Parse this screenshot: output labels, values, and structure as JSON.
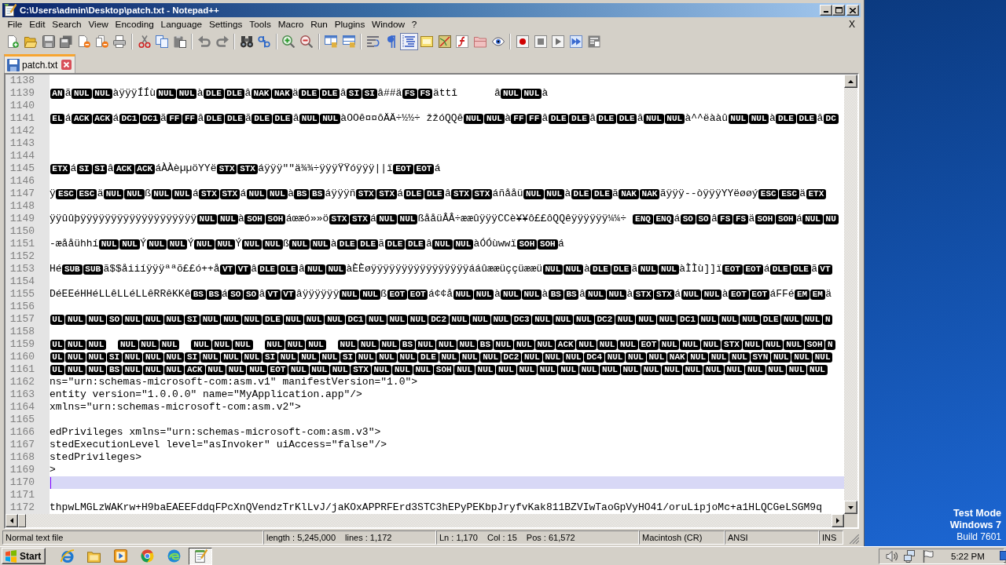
{
  "window": {
    "title": "C:\\Users\\admin\\Desktop\\patch.txt - Notepad++"
  },
  "menu": {
    "items": [
      "File",
      "Edit",
      "Search",
      "View",
      "Encoding",
      "Language",
      "Settings",
      "Tools",
      "Macro",
      "Run",
      "Plugins",
      "Window",
      "?"
    ],
    "close_label": "X"
  },
  "toolbar": {
    "items": [
      {
        "kind": "new",
        "on": false
      },
      {
        "kind": "open",
        "on": false
      },
      {
        "kind": "save",
        "on": false
      },
      {
        "kind": "saveall",
        "on": false
      },
      {
        "kind": "close",
        "on": false
      },
      {
        "kind": "closeall",
        "on": false
      },
      {
        "kind": "print",
        "on": false
      },
      {
        "kind": "sep"
      },
      {
        "kind": "cut",
        "on": false
      },
      {
        "kind": "copy",
        "on": false
      },
      {
        "kind": "paste",
        "on": false
      },
      {
        "kind": "sep"
      },
      {
        "kind": "undo",
        "on": false
      },
      {
        "kind": "redo",
        "on": false
      },
      {
        "kind": "sep"
      },
      {
        "kind": "find",
        "on": false
      },
      {
        "kind": "replace",
        "on": false
      },
      {
        "kind": "sep"
      },
      {
        "kind": "zoomin",
        "on": false
      },
      {
        "kind": "zoomout",
        "on": false
      },
      {
        "kind": "sep"
      },
      {
        "kind": "syncv",
        "on": false
      },
      {
        "kind": "synch",
        "on": false
      },
      {
        "kind": "sep"
      },
      {
        "kind": "wrap",
        "on": false
      },
      {
        "kind": "allchars",
        "on": false
      },
      {
        "kind": "indent",
        "on": true
      },
      {
        "kind": "udl",
        "on": false
      },
      {
        "kind": "docmap",
        "on": false
      },
      {
        "kind": "funclist",
        "on": false
      },
      {
        "kind": "workspace",
        "on": false
      },
      {
        "kind": "monitor",
        "on": false
      },
      {
        "kind": "sep"
      },
      {
        "kind": "record",
        "on": false
      },
      {
        "kind": "stop",
        "on": false
      },
      {
        "kind": "play",
        "on": false
      },
      {
        "kind": "playmulti",
        "on": false
      },
      {
        "kind": "savemacro",
        "on": false
      }
    ]
  },
  "tabs": [
    {
      "label": "patch.txt",
      "selected": true
    }
  ],
  "editor": {
    "lines": [
      {
        "number": "1138",
        "current": false
      },
      {
        "number": "1139",
        "current": false,
        "segments": [
          {
            "kind": "ctrl",
            "text": "AN"
          },
          {
            "kind": "text",
            "text": "ã"
          },
          {
            "kind": "ctrl",
            "text": "NUL"
          },
          {
            "kind": "ctrl",
            "text": "NUL"
          },
          {
            "kind": "text",
            "text": "àÿÿÿÍÍù"
          },
          {
            "kind": "ctrl",
            "text": "NUL"
          },
          {
            "kind": "ctrl",
            "text": "NUL"
          },
          {
            "kind": "text",
            "text": "à"
          },
          {
            "kind": "ctrl",
            "text": "DLE"
          },
          {
            "kind": "ctrl",
            "text": "DLE"
          },
          {
            "kind": "text",
            "text": "â"
          },
          {
            "kind": "ctrl",
            "text": "NAK"
          },
          {
            "kind": "ctrl",
            "text": "NAK"
          },
          {
            "kind": "text",
            "text": "ä"
          },
          {
            "kind": "ctrl",
            "text": "DLE"
          },
          {
            "kind": "ctrl",
            "text": "DLE"
          },
          {
            "kind": "text",
            "text": "â"
          },
          {
            "kind": "ctrl",
            "text": "SI"
          },
          {
            "kind": "ctrl",
            "text": "SI"
          },
          {
            "kind": "text",
            "text": "â##ä"
          },
          {
            "kind": "ctrl",
            "text": "FS"
          },
          {
            "kind": "ctrl",
            "text": "FS"
          },
          {
            "kind": "text",
            "text": "ättî      â"
          },
          {
            "kind": "ctrl",
            "text": "NUL"
          },
          {
            "kind": "ctrl",
            "text": "NUL"
          },
          {
            "kind": "text",
            "text": "à"
          }
        ]
      },
      {
        "number": "1140",
        "current": false
      },
      {
        "number": "1141",
        "current": false,
        "segments": [
          {
            "kind": "ctrl",
            "text": "EL"
          },
          {
            "kind": "text",
            "text": "á"
          },
          {
            "kind": "ctrl",
            "text": "ACK"
          },
          {
            "kind": "ctrl",
            "text": "ACK"
          },
          {
            "kind": "text",
            "text": "á"
          },
          {
            "kind": "ctrl",
            "text": "DC1"
          },
          {
            "kind": "ctrl",
            "text": "DC1"
          },
          {
            "kind": "text",
            "text": "ã"
          },
          {
            "kind": "ctrl",
            "text": "FF"
          },
          {
            "kind": "ctrl",
            "text": "FF"
          },
          {
            "kind": "text",
            "text": "â"
          },
          {
            "kind": "ctrl",
            "text": "DLE"
          },
          {
            "kind": "ctrl",
            "text": "DLE"
          },
          {
            "kind": "text",
            "text": "ã"
          },
          {
            "kind": "ctrl",
            "text": "DLE"
          },
          {
            "kind": "ctrl",
            "text": "DLE"
          },
          {
            "kind": "text",
            "text": "â"
          },
          {
            "kind": "ctrl",
            "text": "NUL"
          },
          {
            "kind": "ctrl",
            "text": "NUL"
          },
          {
            "kind": "text",
            "text": "àOOê¤¤ôÄÄ÷½½÷ žžóQQê"
          },
          {
            "kind": "ctrl",
            "text": "NUL"
          },
          {
            "kind": "ctrl",
            "text": "NUL"
          },
          {
            "kind": "text",
            "text": "à"
          },
          {
            "kind": "ctrl",
            "text": "FF"
          },
          {
            "kind": "ctrl",
            "text": "FF"
          },
          {
            "kind": "text",
            "text": "â"
          },
          {
            "kind": "ctrl",
            "text": "DLE"
          },
          {
            "kind": "ctrl",
            "text": "DLE"
          },
          {
            "kind": "text",
            "text": "â"
          },
          {
            "kind": "ctrl",
            "text": "DLE"
          },
          {
            "kind": "ctrl",
            "text": "DLE"
          },
          {
            "kind": "text",
            "text": "â"
          },
          {
            "kind": "ctrl",
            "text": "NUL"
          },
          {
            "kind": "ctrl",
            "text": "NUL"
          },
          {
            "kind": "text",
            "text": "à^^ëààû"
          },
          {
            "kind": "ctrl",
            "text": "NUL"
          },
          {
            "kind": "ctrl",
            "text": "NUL"
          },
          {
            "kind": "text",
            "text": "à"
          },
          {
            "kind": "ctrl",
            "text": "DLE"
          },
          {
            "kind": "ctrl",
            "text": "DLE"
          },
          {
            "kind": "text",
            "text": "â"
          },
          {
            "kind": "ctrl",
            "text": "DC"
          }
        ]
      },
      {
        "number": "1142",
        "current": false
      },
      {
        "number": "1143",
        "current": false
      },
      {
        "number": "1144",
        "current": false
      },
      {
        "number": "1145",
        "current": false,
        "segments": [
          {
            "kind": "ctrl",
            "text": "ETX"
          },
          {
            "kind": "text",
            "text": "á"
          },
          {
            "kind": "ctrl",
            "text": "SI"
          },
          {
            "kind": "ctrl",
            "text": "SI"
          },
          {
            "kind": "text",
            "text": "â"
          },
          {
            "kind": "ctrl",
            "text": "ACK"
          },
          {
            "kind": "ctrl",
            "text": "ACK"
          },
          {
            "kind": "text",
            "text": "áÀÀèµµöYYë"
          },
          {
            "kind": "ctrl",
            "text": "STX"
          },
          {
            "kind": "ctrl",
            "text": "STX"
          },
          {
            "kind": "text",
            "text": "áÿÿÿ\"\"ä¾¾÷ÿÿÿŸŸóÿÿÿ||ï"
          },
          {
            "kind": "ctrl",
            "text": "EOT"
          },
          {
            "kind": "ctrl",
            "text": "EOT"
          },
          {
            "kind": "text",
            "text": "á"
          }
        ]
      },
      {
        "number": "1146",
        "current": false
      },
      {
        "number": "1147",
        "current": false,
        "segments": [
          {
            "kind": "text",
            "text": "ÿ"
          },
          {
            "kind": "ctrl",
            "text": "ESC"
          },
          {
            "kind": "ctrl",
            "text": "ESC"
          },
          {
            "kind": "text",
            "text": "ä"
          },
          {
            "kind": "ctrl",
            "text": "NUL"
          },
          {
            "kind": "ctrl",
            "text": "NUL"
          },
          {
            "kind": "text",
            "text": "ß"
          },
          {
            "kind": "ctrl",
            "text": "NUL"
          },
          {
            "kind": "ctrl",
            "text": "NUL"
          },
          {
            "kind": "text",
            "text": "á"
          },
          {
            "kind": "ctrl",
            "text": "STX"
          },
          {
            "kind": "ctrl",
            "text": "STX"
          },
          {
            "kind": "text",
            "text": "á"
          },
          {
            "kind": "ctrl",
            "text": "NUL"
          },
          {
            "kind": "ctrl",
            "text": "NUL"
          },
          {
            "kind": "text",
            "text": "à"
          },
          {
            "kind": "ctrl",
            "text": "BS"
          },
          {
            "kind": "ctrl",
            "text": "BS"
          },
          {
            "kind": "text",
            "text": "áÿÿÿñ"
          },
          {
            "kind": "ctrl",
            "text": "STX"
          },
          {
            "kind": "ctrl",
            "text": "STX"
          },
          {
            "kind": "text",
            "text": "á"
          },
          {
            "kind": "ctrl",
            "text": "DLE"
          },
          {
            "kind": "ctrl",
            "text": "DLE"
          },
          {
            "kind": "text",
            "text": "â"
          },
          {
            "kind": "ctrl",
            "text": "STX"
          },
          {
            "kind": "ctrl",
            "text": "STX"
          },
          {
            "kind": "text",
            "text": "áñååü"
          },
          {
            "kind": "ctrl",
            "text": "NUL"
          },
          {
            "kind": "ctrl",
            "text": "NUL"
          },
          {
            "kind": "text",
            "text": "à"
          },
          {
            "kind": "ctrl",
            "text": "DLE"
          },
          {
            "kind": "ctrl",
            "text": "DLE"
          },
          {
            "kind": "text",
            "text": "ã"
          },
          {
            "kind": "ctrl",
            "text": "NAK"
          },
          {
            "kind": "ctrl",
            "text": "NAK"
          },
          {
            "kind": "text",
            "text": "ãÿÿÿ--òÿÿÿYYëøøý"
          },
          {
            "kind": "ctrl",
            "text": "ESC"
          },
          {
            "kind": "ctrl",
            "text": "ESC"
          },
          {
            "kind": "text",
            "text": "ä"
          },
          {
            "kind": "ctrl",
            "text": "ETX"
          }
        ]
      },
      {
        "number": "1148",
        "current": false
      },
      {
        "number": "1149",
        "current": false,
        "segments": [
          {
            "kind": "text",
            "text": "ÿÿûûþÿÿÿÿÿÿÿÿÿÿÿÿÿÿÿÿÿÿÿ"
          },
          {
            "kind": "ctrl",
            "text": "NUL"
          },
          {
            "kind": "ctrl",
            "text": "NUL"
          },
          {
            "kind": "text",
            "text": "à"
          },
          {
            "kind": "ctrl",
            "text": "SOH"
          },
          {
            "kind": "ctrl",
            "text": "SOH"
          },
          {
            "kind": "text",
            "text": "áœæó»»ö"
          },
          {
            "kind": "ctrl",
            "text": "STX"
          },
          {
            "kind": "ctrl",
            "text": "STX"
          },
          {
            "kind": "text",
            "text": "á"
          },
          {
            "kind": "ctrl",
            "text": "NUL"
          },
          {
            "kind": "ctrl",
            "text": "NUL"
          },
          {
            "kind": "text",
            "text": "ßååüÂÂ÷ææûÿÿÿCCè¥¥ô££ôQQêÿÿÿÿÿÿ¼¼÷ "
          },
          {
            "kind": "ctrl",
            "text": "ENQ"
          },
          {
            "kind": "ctrl",
            "text": "ENQ"
          },
          {
            "kind": "text",
            "text": "á"
          },
          {
            "kind": "ctrl",
            "text": "SO"
          },
          {
            "kind": "ctrl",
            "text": "SO"
          },
          {
            "kind": "text",
            "text": "â"
          },
          {
            "kind": "ctrl",
            "text": "FS"
          },
          {
            "kind": "ctrl",
            "text": "FS"
          },
          {
            "kind": "text",
            "text": "ä"
          },
          {
            "kind": "ctrl",
            "text": "SOH"
          },
          {
            "kind": "ctrl",
            "text": "SOH"
          },
          {
            "kind": "text",
            "text": "á"
          },
          {
            "kind": "ctrl",
            "text": "NUL"
          },
          {
            "kind": "ctrl",
            "text": "NU"
          }
        ]
      },
      {
        "number": "1150",
        "current": false
      },
      {
        "number": "1151",
        "current": false,
        "segments": [
          {
            "kind": "text",
            "text": "-æååühhí"
          },
          {
            "kind": "ctrl",
            "text": "NUL"
          },
          {
            "kind": "ctrl",
            "text": "NUL"
          },
          {
            "kind": "text",
            "text": "Ý"
          },
          {
            "kind": "ctrl",
            "text": "NUL"
          },
          {
            "kind": "ctrl",
            "text": "NUL"
          },
          {
            "kind": "text",
            "text": "Ý"
          },
          {
            "kind": "ctrl",
            "text": "NUL"
          },
          {
            "kind": "ctrl",
            "text": "NUL"
          },
          {
            "kind": "text",
            "text": "Ý"
          },
          {
            "kind": "ctrl",
            "text": "NUL"
          },
          {
            "kind": "ctrl",
            "text": "NUL"
          },
          {
            "kind": "text",
            "text": "ß"
          },
          {
            "kind": "ctrl",
            "text": "NUL"
          },
          {
            "kind": "ctrl",
            "text": "NUL"
          },
          {
            "kind": "text",
            "text": "à"
          },
          {
            "kind": "ctrl",
            "text": "DLE"
          },
          {
            "kind": "ctrl",
            "text": "DLE"
          },
          {
            "kind": "text",
            "text": "ã"
          },
          {
            "kind": "ctrl",
            "text": "DLE"
          },
          {
            "kind": "ctrl",
            "text": "DLE"
          },
          {
            "kind": "text",
            "text": "â"
          },
          {
            "kind": "ctrl",
            "text": "NUL"
          },
          {
            "kind": "ctrl",
            "text": "NUL"
          },
          {
            "kind": "text",
            "text": "àÓÓùwwï"
          },
          {
            "kind": "ctrl",
            "text": "SOH"
          },
          {
            "kind": "ctrl",
            "text": "SOH"
          },
          {
            "kind": "text",
            "text": "á"
          }
        ]
      },
      {
        "number": "1152",
        "current": false
      },
      {
        "number": "1153",
        "current": false,
        "segments": [
          {
            "kind": "text",
            "text": "Hé"
          },
          {
            "kind": "ctrl",
            "text": "SUB"
          },
          {
            "kind": "ctrl",
            "text": "SUB"
          },
          {
            "kind": "text",
            "text": "ã$$åiiíÿÿÿªªõ££ó++å"
          },
          {
            "kind": "ctrl",
            "text": "VT"
          },
          {
            "kind": "ctrl",
            "text": "VT"
          },
          {
            "kind": "text",
            "text": "â"
          },
          {
            "kind": "ctrl",
            "text": "DLE"
          },
          {
            "kind": "ctrl",
            "text": "DLE"
          },
          {
            "kind": "text",
            "text": "â"
          },
          {
            "kind": "ctrl",
            "text": "NUL"
          },
          {
            "kind": "ctrl",
            "text": "NUL"
          },
          {
            "kind": "text",
            "text": "àÈÈøÿÿÿÿÿÿÿÿÿÿÿÿÿÿÿÿááûææüççüææü"
          },
          {
            "kind": "ctrl",
            "text": "NUL"
          },
          {
            "kind": "ctrl",
            "text": "NUL"
          },
          {
            "kind": "text",
            "text": "à"
          },
          {
            "kind": "ctrl",
            "text": "DLE"
          },
          {
            "kind": "ctrl",
            "text": "DLE"
          },
          {
            "kind": "text",
            "text": "ã"
          },
          {
            "kind": "ctrl",
            "text": "NUL"
          },
          {
            "kind": "ctrl",
            "text": "NUL"
          },
          {
            "kind": "text",
            "text": "àÌÌù]]ï"
          },
          {
            "kind": "ctrl",
            "text": "EOT"
          },
          {
            "kind": "ctrl",
            "text": "EOT"
          },
          {
            "kind": "text",
            "text": "á"
          },
          {
            "kind": "ctrl",
            "text": "DLE"
          },
          {
            "kind": "ctrl",
            "text": "DLE"
          },
          {
            "kind": "text",
            "text": "ã"
          },
          {
            "kind": "ctrl",
            "text": "VT"
          }
        ]
      },
      {
        "number": "1154",
        "current": false
      },
      {
        "number": "1155",
        "current": false,
        "segments": [
          {
            "kind": "text",
            "text": "DéEEéHHéLLêLLéLLêRRêKKê"
          },
          {
            "kind": "ctrl",
            "text": "BS"
          },
          {
            "kind": "ctrl",
            "text": "BS"
          },
          {
            "kind": "text",
            "text": "á"
          },
          {
            "kind": "ctrl",
            "text": "SO"
          },
          {
            "kind": "ctrl",
            "text": "SO"
          },
          {
            "kind": "text",
            "text": "â"
          },
          {
            "kind": "ctrl",
            "text": "VT"
          },
          {
            "kind": "ctrl",
            "text": "VT"
          },
          {
            "kind": "text",
            "text": "âÿÿÿÿÿÿ"
          },
          {
            "kind": "ctrl",
            "text": "NUL"
          },
          {
            "kind": "ctrl",
            "text": "NUL"
          },
          {
            "kind": "text",
            "text": "ß"
          },
          {
            "kind": "ctrl",
            "text": "EOT"
          },
          {
            "kind": "ctrl",
            "text": "EOT"
          },
          {
            "kind": "text",
            "text": "á¢¢å"
          },
          {
            "kind": "ctrl",
            "text": "NUL"
          },
          {
            "kind": "ctrl",
            "text": "NUL"
          },
          {
            "kind": "text",
            "text": "à"
          },
          {
            "kind": "ctrl",
            "text": "NUL"
          },
          {
            "kind": "ctrl",
            "text": "NUL"
          },
          {
            "kind": "text",
            "text": "à"
          },
          {
            "kind": "ctrl",
            "text": "BS"
          },
          {
            "kind": "ctrl",
            "text": "BS"
          },
          {
            "kind": "text",
            "text": "â"
          },
          {
            "kind": "ctrl",
            "text": "NUL"
          },
          {
            "kind": "ctrl",
            "text": "NUL"
          },
          {
            "kind": "text",
            "text": "à"
          },
          {
            "kind": "ctrl",
            "text": "STX"
          },
          {
            "kind": "ctrl",
            "text": "STX"
          },
          {
            "kind": "text",
            "text": "á"
          },
          {
            "kind": "ctrl",
            "text": "NUL"
          },
          {
            "kind": "ctrl",
            "text": "NUL"
          },
          {
            "kind": "text",
            "text": "à"
          },
          {
            "kind": "ctrl",
            "text": "EOT"
          },
          {
            "kind": "ctrl",
            "text": "EOT"
          },
          {
            "kind": "text",
            "text": "áFFé"
          },
          {
            "kind": "ctrl",
            "text": "EM"
          },
          {
            "kind": "ctrl",
            "text": "EM"
          },
          {
            "kind": "text",
            "text": "ä"
          }
        ]
      },
      {
        "number": "1156",
        "current": false
      },
      {
        "number": "1157",
        "current": false,
        "segments": [
          {
            "kind": "ctrl",
            "text": "UL"
          },
          {
            "kind": "ctrl",
            "text": "NUL"
          },
          {
            "kind": "ctrl",
            "text": "NUL"
          },
          {
            "kind": "ctrl",
            "text": "SO"
          },
          {
            "kind": "ctrl",
            "text": "NUL"
          },
          {
            "kind": "ctrl",
            "text": "NUL"
          },
          {
            "kind": "ctrl",
            "text": "NUL"
          },
          {
            "kind": "ctrl",
            "text": "SI"
          },
          {
            "kind": "ctrl",
            "text": "NUL"
          },
          {
            "kind": "ctrl",
            "text": "NUL"
          },
          {
            "kind": "ctrl",
            "text": "NUL"
          },
          {
            "kind": "ctrl",
            "text": "DLE"
          },
          {
            "kind": "ctrl",
            "text": "NUL"
          },
          {
            "kind": "ctrl",
            "text": "NUL"
          },
          {
            "kind": "ctrl",
            "text": "NUL"
          },
          {
            "kind": "ctrl",
            "text": "DC1"
          },
          {
            "kind": "ctrl",
            "text": "NUL"
          },
          {
            "kind": "ctrl",
            "text": "NUL"
          },
          {
            "kind": "ctrl",
            "text": "NUL"
          },
          {
            "kind": "ctrl",
            "text": "DC2"
          },
          {
            "kind": "ctrl",
            "text": "NUL"
          },
          {
            "kind": "ctrl",
            "text": "NUL"
          },
          {
            "kind": "ctrl",
            "text": "NUL"
          },
          {
            "kind": "ctrl",
            "text": "DC3"
          },
          {
            "kind": "ctrl",
            "text": "NUL"
          },
          {
            "kind": "ctrl",
            "text": "NUL"
          },
          {
            "kind": "ctrl",
            "text": "NUL"
          },
          {
            "kind": "ctrl",
            "text": "DC2"
          },
          {
            "kind": "ctrl",
            "text": "NUL"
          },
          {
            "kind": "ctrl",
            "text": "NUL"
          },
          {
            "kind": "ctrl",
            "text": "NUL"
          },
          {
            "kind": "ctrl",
            "text": "DC1"
          },
          {
            "kind": "ctrl",
            "text": "NUL"
          },
          {
            "kind": "ctrl",
            "text": "NUL"
          },
          {
            "kind": "ctrl",
            "text": "NUL"
          },
          {
            "kind": "ctrl",
            "text": "DLE"
          },
          {
            "kind": "ctrl",
            "text": "NUL"
          },
          {
            "kind": "ctrl",
            "text": "NUL"
          },
          {
            "kind": "ctrl",
            "text": "N"
          }
        ]
      },
      {
        "number": "1158",
        "current": false
      },
      {
        "number": "1159",
        "current": false,
        "segments": [
          {
            "kind": "ctrl",
            "text": "UL"
          },
          {
            "kind": "ctrl",
            "text": "NUL"
          },
          {
            "kind": "ctrl",
            "text": "NUL"
          },
          {
            "kind": "tab"
          },
          {
            "kind": "ctrl",
            "text": "NUL"
          },
          {
            "kind": "ctrl",
            "text": "NUL"
          },
          {
            "kind": "ctrl",
            "text": "NUL"
          },
          {
            "kind": "tab"
          },
          {
            "kind": "ctrl",
            "text": "NUL"
          },
          {
            "kind": "ctrl",
            "text": "NUL"
          },
          {
            "kind": "ctrl",
            "text": "NUL"
          },
          {
            "kind": "tab"
          },
          {
            "kind": "ctrl",
            "text": "NUL"
          },
          {
            "kind": "ctrl",
            "text": "NUL"
          },
          {
            "kind": "ctrl",
            "text": "NUL"
          },
          {
            "kind": "tab"
          },
          {
            "kind": "ctrl",
            "text": "NUL"
          },
          {
            "kind": "ctrl",
            "text": "NUL"
          },
          {
            "kind": "ctrl",
            "text": "NUL"
          },
          {
            "kind": "ctrl",
            "text": "BS"
          },
          {
            "kind": "ctrl",
            "text": "NUL"
          },
          {
            "kind": "ctrl",
            "text": "NUL"
          },
          {
            "kind": "ctrl",
            "text": "NUL"
          },
          {
            "kind": "ctrl",
            "text": "BS"
          },
          {
            "kind": "ctrl",
            "text": "NUL"
          },
          {
            "kind": "ctrl",
            "text": "NUL"
          },
          {
            "kind": "ctrl",
            "text": "NUL"
          },
          {
            "kind": "ctrl",
            "text": "ACK"
          },
          {
            "kind": "ctrl",
            "text": "NUL"
          },
          {
            "kind": "ctrl",
            "text": "NUL"
          },
          {
            "kind": "ctrl",
            "text": "NUL"
          },
          {
            "kind": "ctrl",
            "text": "EOT"
          },
          {
            "kind": "ctrl",
            "text": "NUL"
          },
          {
            "kind": "ctrl",
            "text": "NUL"
          },
          {
            "kind": "ctrl",
            "text": "NUL"
          },
          {
            "kind": "ctrl",
            "text": "STX"
          },
          {
            "kind": "ctrl",
            "text": "NUL"
          },
          {
            "kind": "ctrl",
            "text": "NUL"
          },
          {
            "kind": "ctrl",
            "text": "NUL"
          },
          {
            "kind": "ctrl",
            "text": "SOH"
          },
          {
            "kind": "ctrl",
            "text": "N"
          }
        ]
      },
      {
        "number": "1160",
        "current": false,
        "segments": [
          {
            "kind": "ctrl",
            "text": "UL"
          },
          {
            "kind": "ctrl",
            "text": "NUL"
          },
          {
            "kind": "ctrl",
            "text": "NUL"
          },
          {
            "kind": "ctrl",
            "text": "SI"
          },
          {
            "kind": "ctrl",
            "text": "NUL"
          },
          {
            "kind": "ctrl",
            "text": "NUL"
          },
          {
            "kind": "ctrl",
            "text": "NUL"
          },
          {
            "kind": "ctrl",
            "text": "SI"
          },
          {
            "kind": "ctrl",
            "text": "NUL"
          },
          {
            "kind": "ctrl",
            "text": "NUL"
          },
          {
            "kind": "ctrl",
            "text": "NUL"
          },
          {
            "kind": "ctrl",
            "text": "SI"
          },
          {
            "kind": "ctrl",
            "text": "NUL"
          },
          {
            "kind": "ctrl",
            "text": "NUL"
          },
          {
            "kind": "ctrl",
            "text": "NUL"
          },
          {
            "kind": "ctrl",
            "text": "SI"
          },
          {
            "kind": "ctrl",
            "text": "NUL"
          },
          {
            "kind": "ctrl",
            "text": "NUL"
          },
          {
            "kind": "ctrl",
            "text": "NUL"
          },
          {
            "kind": "ctrl",
            "text": "DLE"
          },
          {
            "kind": "ctrl",
            "text": "NUL"
          },
          {
            "kind": "ctrl",
            "text": "NUL"
          },
          {
            "kind": "ctrl",
            "text": "NUL"
          },
          {
            "kind": "ctrl",
            "text": "DC2"
          },
          {
            "kind": "ctrl",
            "text": "NUL"
          },
          {
            "kind": "ctrl",
            "text": "NUL"
          },
          {
            "kind": "ctrl",
            "text": "NUL"
          },
          {
            "kind": "ctrl",
            "text": "DC4"
          },
          {
            "kind": "ctrl",
            "text": "NUL"
          },
          {
            "kind": "ctrl",
            "text": "NUL"
          },
          {
            "kind": "ctrl",
            "text": "NUL"
          },
          {
            "kind": "ctrl",
            "text": "NAK"
          },
          {
            "kind": "ctrl",
            "text": "NUL"
          },
          {
            "kind": "ctrl",
            "text": "NUL"
          },
          {
            "kind": "ctrl",
            "text": "NUL"
          },
          {
            "kind": "ctrl",
            "text": "SYN"
          },
          {
            "kind": "ctrl",
            "text": "NUL"
          },
          {
            "kind": "ctrl",
            "text": "NUL"
          },
          {
            "kind": "ctrl",
            "text": "NUL"
          }
        ]
      },
      {
        "number": "1161",
        "current": false,
        "segments": [
          {
            "kind": "ctrl",
            "text": "UL"
          },
          {
            "kind": "ctrl",
            "text": "NUL"
          },
          {
            "kind": "ctrl",
            "text": "NUL"
          },
          {
            "kind": "ctrl",
            "text": "BS"
          },
          {
            "kind": "ctrl",
            "text": "NUL"
          },
          {
            "kind": "ctrl",
            "text": "NUL"
          },
          {
            "kind": "ctrl",
            "text": "NUL"
          },
          {
            "kind": "ctrl",
            "text": "ACK"
          },
          {
            "kind": "ctrl",
            "text": "NUL"
          },
          {
            "kind": "ctrl",
            "text": "NUL"
          },
          {
            "kind": "ctrl",
            "text": "NUL"
          },
          {
            "kind": "ctrl",
            "text": "EOT"
          },
          {
            "kind": "ctrl",
            "text": "NUL"
          },
          {
            "kind": "ctrl",
            "text": "NUL"
          },
          {
            "kind": "ctrl",
            "text": "NUL"
          },
          {
            "kind": "ctrl",
            "text": "STX"
          },
          {
            "kind": "ctrl",
            "text": "NUL"
          },
          {
            "kind": "ctrl",
            "text": "NUL"
          },
          {
            "kind": "ctrl",
            "text": "NUL"
          },
          {
            "kind": "ctrl",
            "text": "SOH"
          },
          {
            "kind": "ctrl",
            "text": "NUL"
          },
          {
            "kind": "ctrl",
            "text": "NUL"
          },
          {
            "kind": "ctrl",
            "text": "NUL"
          },
          {
            "kind": "ctrl",
            "text": "NUL"
          },
          {
            "kind": "ctrl",
            "text": "NUL"
          },
          {
            "kind": "ctrl",
            "text": "NUL"
          },
          {
            "kind": "ctrl",
            "text": "NUL"
          },
          {
            "kind": "ctrl",
            "text": "NUL"
          },
          {
            "kind": "ctrl",
            "text": "NUL"
          },
          {
            "kind": "ctrl",
            "text": "NUL"
          },
          {
            "kind": "ctrl",
            "text": "NUL"
          },
          {
            "kind": "ctrl",
            "text": "NUL"
          },
          {
            "kind": "ctrl",
            "text": "NUL"
          },
          {
            "kind": "ctrl",
            "text": "NUL"
          },
          {
            "kind": "ctrl",
            "text": "NUL"
          },
          {
            "kind": "ctrl",
            "text": "NUL"
          },
          {
            "kind": "ctrl",
            "text": "NUL"
          },
          {
            "kind": "ctrl",
            "text": "NUL"
          }
        ]
      },
      {
        "number": "1162",
        "current": false,
        "segments": [
          {
            "kind": "text",
            "text": "ns=\"urn:schemas-microsoft-com:asm.v1\" manifestVersion=\"1.0\">"
          }
        ]
      },
      {
        "number": "1163",
        "current": false,
        "segments": [
          {
            "kind": "text",
            "text": "entity version=\"1.0.0.0\" name=\"MyApplication.app\"/>"
          }
        ]
      },
      {
        "number": "1164",
        "current": false,
        "segments": [
          {
            "kind": "text",
            "text": "xmlns=\"urn:schemas-microsoft-com:asm.v2\">"
          }
        ]
      },
      {
        "number": "1165",
        "current": false
      },
      {
        "number": "1166",
        "current": false,
        "segments": [
          {
            "kind": "text",
            "text": "edPrivileges xmlns=\"urn:schemas-microsoft-com:asm.v3\">"
          }
        ]
      },
      {
        "number": "1167",
        "current": false,
        "segments": [
          {
            "kind": "text",
            "text": "stedExecutionLevel level=\"asInvoker\" uiAccess=\"false\"/>"
          }
        ]
      },
      {
        "number": "1168",
        "current": false,
        "segments": [
          {
            "kind": "text",
            "text": "stedPrivileges>"
          }
        ]
      },
      {
        "number": "1169",
        "current": false,
        "segments": [
          {
            "kind": "text",
            "text": ">"
          }
        ]
      },
      {
        "number": "1170",
        "current": true
      },
      {
        "number": "1171",
        "current": false
      },
      {
        "number": "1172",
        "current": false,
        "segments": [
          {
            "kind": "text",
            "text": "thpwLMGLzWAKrw+H9baEAEEFddqFPcXnQVendzTrKlLvJ/jaKOxAPPRFErd3STC3hEPyPEKbpJryfvKak811BZVIwTaoGpVyHO41/oruLipjoMc+a1HLQCGeLSGM9q"
          }
        ]
      }
    ]
  },
  "status_bar": {
    "panels": [
      {
        "texts": [
          "Normal text file"
        ]
      },
      {
        "texts": [
          "length : 5,245,000",
          "lines : 1,172"
        ]
      },
      {
        "texts": [
          "Ln : 1,170",
          "Col : 15",
          "Pos : 61,572"
        ]
      },
      {
        "texts": [
          "Macintosh (CR)"
        ]
      },
      {
        "texts": [
          "ANSI"
        ]
      },
      {
        "texts": [
          "INS"
        ]
      }
    ]
  },
  "desktop": {
    "notice": [
      "Test Mode",
      "Windows 7",
      "Build 7601"
    ]
  },
  "taskbar": {
    "start_label": "Start",
    "apps": [
      {
        "kind": "ie",
        "selected": false
      },
      {
        "kind": "explorer",
        "selected": false
      },
      {
        "kind": "media",
        "selected": false
      },
      {
        "kind": "chrome",
        "selected": false
      },
      {
        "kind": "edge",
        "selected": false
      },
      {
        "kind": "notepad",
        "selected": true
      }
    ],
    "clock": "5:22 PM"
  }
}
